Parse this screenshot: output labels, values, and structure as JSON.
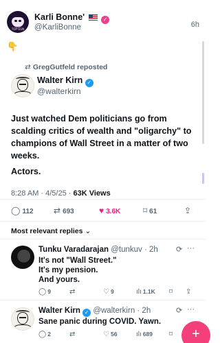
{
  "top_post": {
    "name": "Karli Bonne'",
    "handle": "@KarliBonne",
    "time": "6h",
    "text": "👇",
    "avatar_text": "TOP GUN"
  },
  "repost": {
    "label": "GregGutfeld reposted",
    "icon": "repost-icon"
  },
  "main_post": {
    "name": "Walter Kirn",
    "handle": "@walterkirn",
    "text": "Just watched Dem politicians go from scalding  critics of wealth and \"oligarchy\" to champions of Wall Street in a matter of two weeks.",
    "text2": "Actors.",
    "time": "8:28 AM · 4/5/25 · ",
    "views": "63K Views",
    "stats": {
      "replies": "112",
      "reposts": "693",
      "likes": "3.6K",
      "bookmarks": "61"
    }
  },
  "replies_filter": "Most relevant replies",
  "replies": [
    {
      "name": "Tunku  Varadarajan",
      "handle": "@tunkuv · 2h",
      "lines": [
        "It's not \"Wall Street.\"",
        "It's my pension.",
        "And yours."
      ],
      "stats": {
        "replies": "9",
        "reposts": "",
        "likes": "9",
        "views": "1.1K"
      }
    },
    {
      "name": "Walter Kirn",
      "handle": "@walterkirn · 2h",
      "lines": [
        "Sane panic during COVID. Yawn."
      ],
      "stats": {
        "replies": "2",
        "reposts": "",
        "likes": "56",
        "views": "689"
      }
    }
  ],
  "colors": {
    "like": "#f91880",
    "verified": "#1d9bf0",
    "fab": "#f43f7a"
  }
}
